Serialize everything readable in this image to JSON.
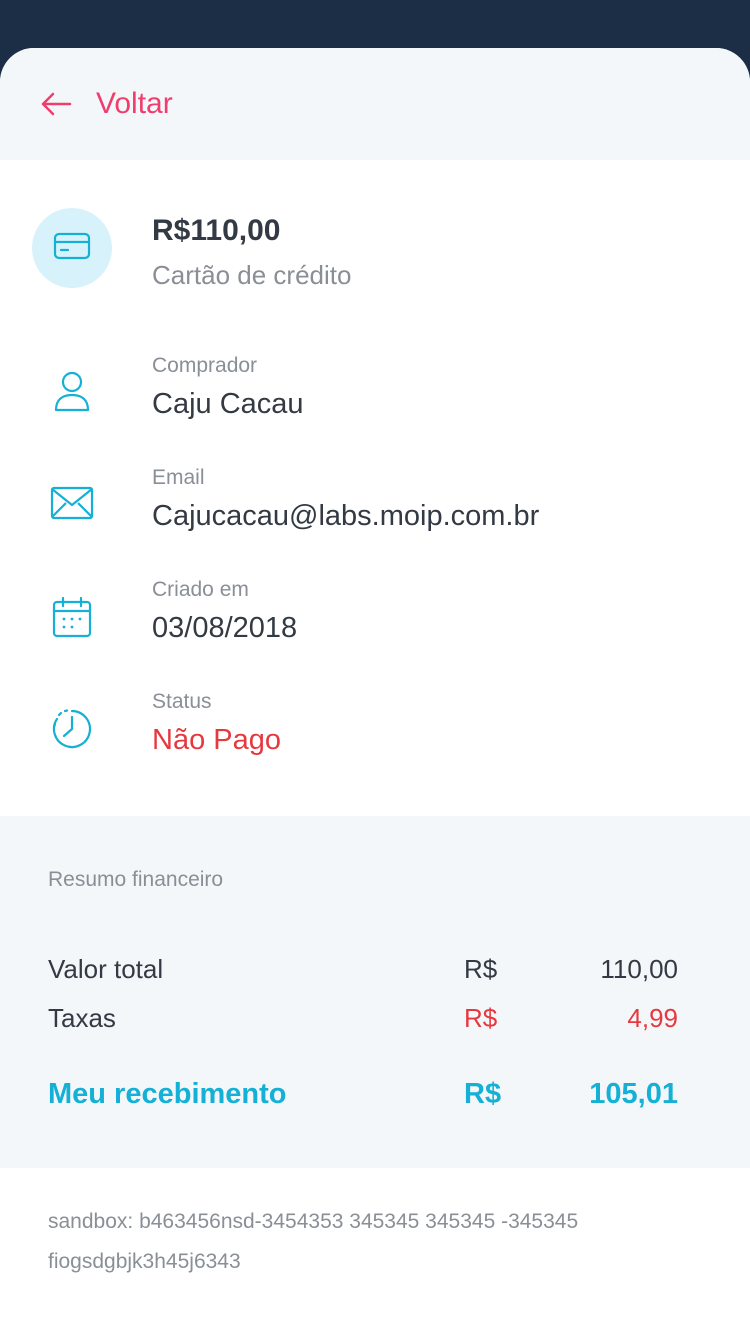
{
  "header": {
    "back_label": "Voltar"
  },
  "payment": {
    "amount": "R$110,00",
    "method": "Cartão de crédito"
  },
  "details": [
    {
      "icon": "user-icon",
      "label": "Comprador",
      "value": "Caju Cacau"
    },
    {
      "icon": "mail-icon",
      "label": "Email",
      "value": "Cajucacau@labs.moip.com.br"
    },
    {
      "icon": "calendar-icon",
      "label": "Criado em",
      "value": "03/08/2018"
    },
    {
      "icon": "clock-icon",
      "label": "Status",
      "value": "Não Pago"
    }
  ],
  "summary": {
    "title": "Resumo financeiro",
    "rows": [
      {
        "name": "Valor total",
        "currency": "R$",
        "value": "110,00"
      },
      {
        "name": "Taxas",
        "currency": "R$",
        "value": "4,99"
      },
      {
        "name": "Meu recebimento",
        "currency": "R$",
        "value": "105,01"
      }
    ]
  },
  "footer": {
    "line1": "sandbox: b463456nsd-3454353 345345 345345 -345345",
    "line2": "fiogsdgbjk3h45j6343"
  },
  "colors": {
    "accent_pink": "#ef3e6e",
    "accent_blue": "#14b0d6",
    "status_red": "#e6393f",
    "top_bar": "#1b2e45"
  }
}
